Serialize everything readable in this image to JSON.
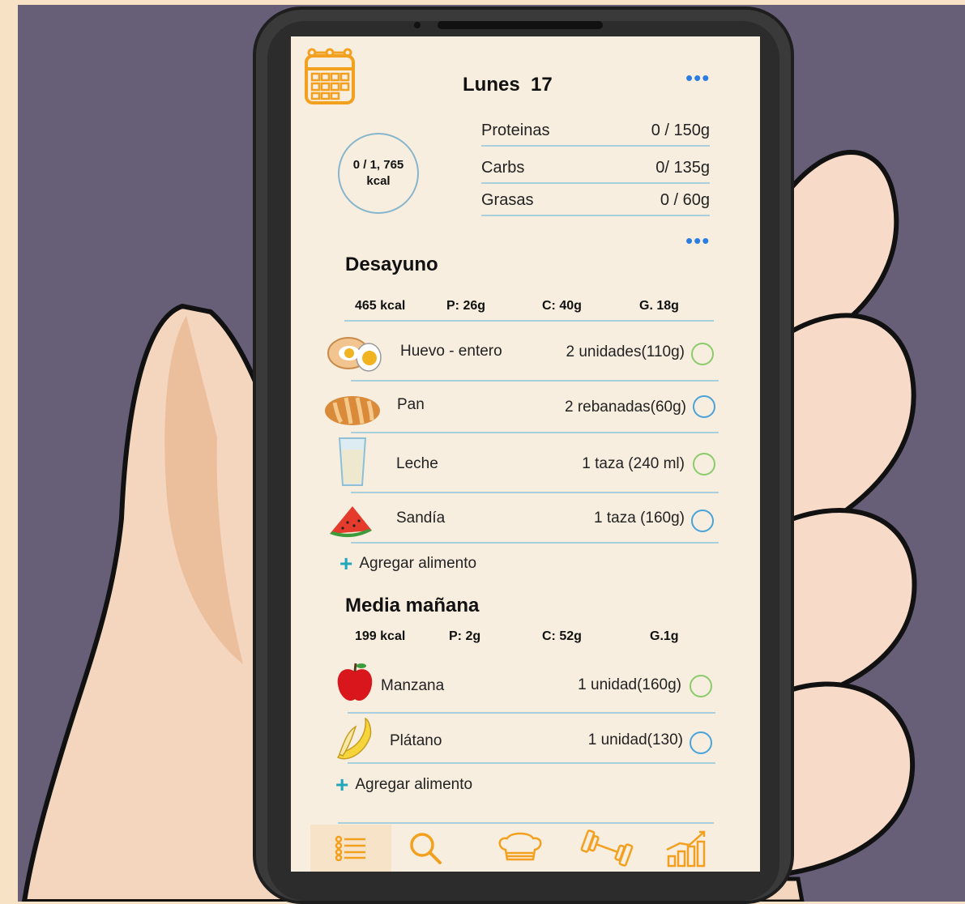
{
  "colors": {
    "accent": "#f3a01e",
    "link": "#2a7de1",
    "divider": "#a9cfdc",
    "check_green": "#8bcb6b",
    "check_blue": "#4aa3d8"
  },
  "header": {
    "title": "Lunes  17"
  },
  "summary": {
    "kcal_line1": "0 / 1, 765",
    "kcal_line2": "kcal",
    "macros": [
      {
        "label": "Proteinas",
        "value": "0 / 150g"
      },
      {
        "label": "Carbs",
        "value": "0/ 135g"
      },
      {
        "label": "Grasas",
        "value": "0 / 60g"
      }
    ]
  },
  "meals": [
    {
      "title": "Desayuno",
      "kcal": "465 kcal",
      "p": "P: 26g",
      "c": "C: 40g",
      "g": "G. 18g",
      "foods": [
        {
          "name": "Huevo - entero",
          "qty": "2 unidades(110g)",
          "icon": "egg-icon"
        },
        {
          "name": "Pan",
          "qty": "2 rebanadas(60g)",
          "icon": "bread-icon"
        },
        {
          "name": "Leche",
          "qty": "1 taza (240 ml)",
          "icon": "milk-glass-icon"
        },
        {
          "name": "Sandía",
          "qty": "1 taza (160g)",
          "icon": "watermelon-icon"
        }
      ],
      "add_label": "Agregar alimento"
    },
    {
      "title": "Media mañana",
      "kcal": "199 kcal",
      "p": "P: 2g",
      "c": "C: 52g",
      "g": "G.1g",
      "foods": [
        {
          "name": "Manzana",
          "qty": "1 unidad(160g)",
          "icon": "apple-icon"
        },
        {
          "name": "Plátano",
          "qty": "1 unidad(130)",
          "icon": "banana-icon"
        }
      ],
      "add_label": "Agregar alimento"
    }
  ],
  "tabs": [
    "list-icon",
    "search-icon",
    "chef-hat-icon",
    "dumbbell-icon",
    "growth-chart-icon"
  ]
}
